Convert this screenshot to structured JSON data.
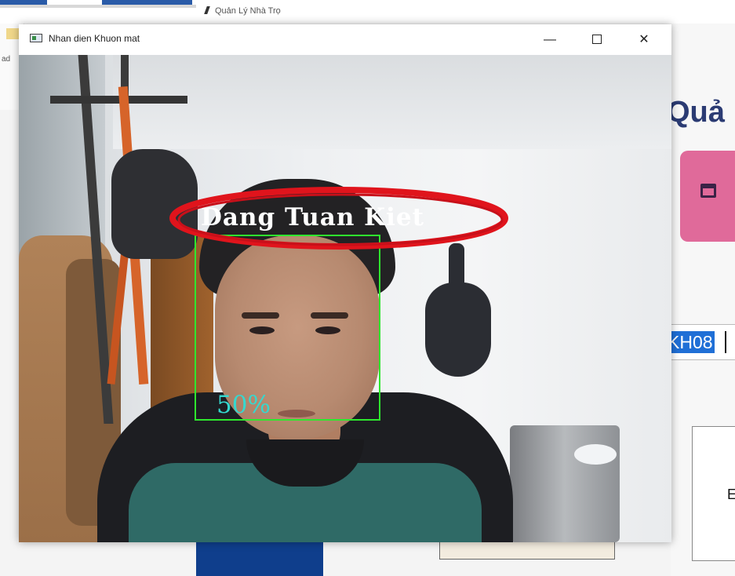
{
  "background_app": {
    "title": "Quản Lý Nhà Trọ",
    "left_text": "ad",
    "heading": "Quả",
    "id_value": "KH08",
    "box_letter": "E",
    "pink_card_icon": "calendar-icon",
    "colors": {
      "heading": "#2b3b73",
      "pink_card": "#e06a9a",
      "selection": "#1f6fd6",
      "nav_blue": "#0f3e8c"
    }
  },
  "window": {
    "title": "Nhan dien Khuon mat",
    "controls": {
      "minimize": "—",
      "maximize": "",
      "close": "✕"
    }
  },
  "recognition": {
    "name": "Dang Tuan Kiet",
    "confidence": "50%",
    "colors": {
      "box": "#2ee82e",
      "name": "#ffffff",
      "confidence": "#35d8cf",
      "annotation": "#e0141c"
    }
  }
}
